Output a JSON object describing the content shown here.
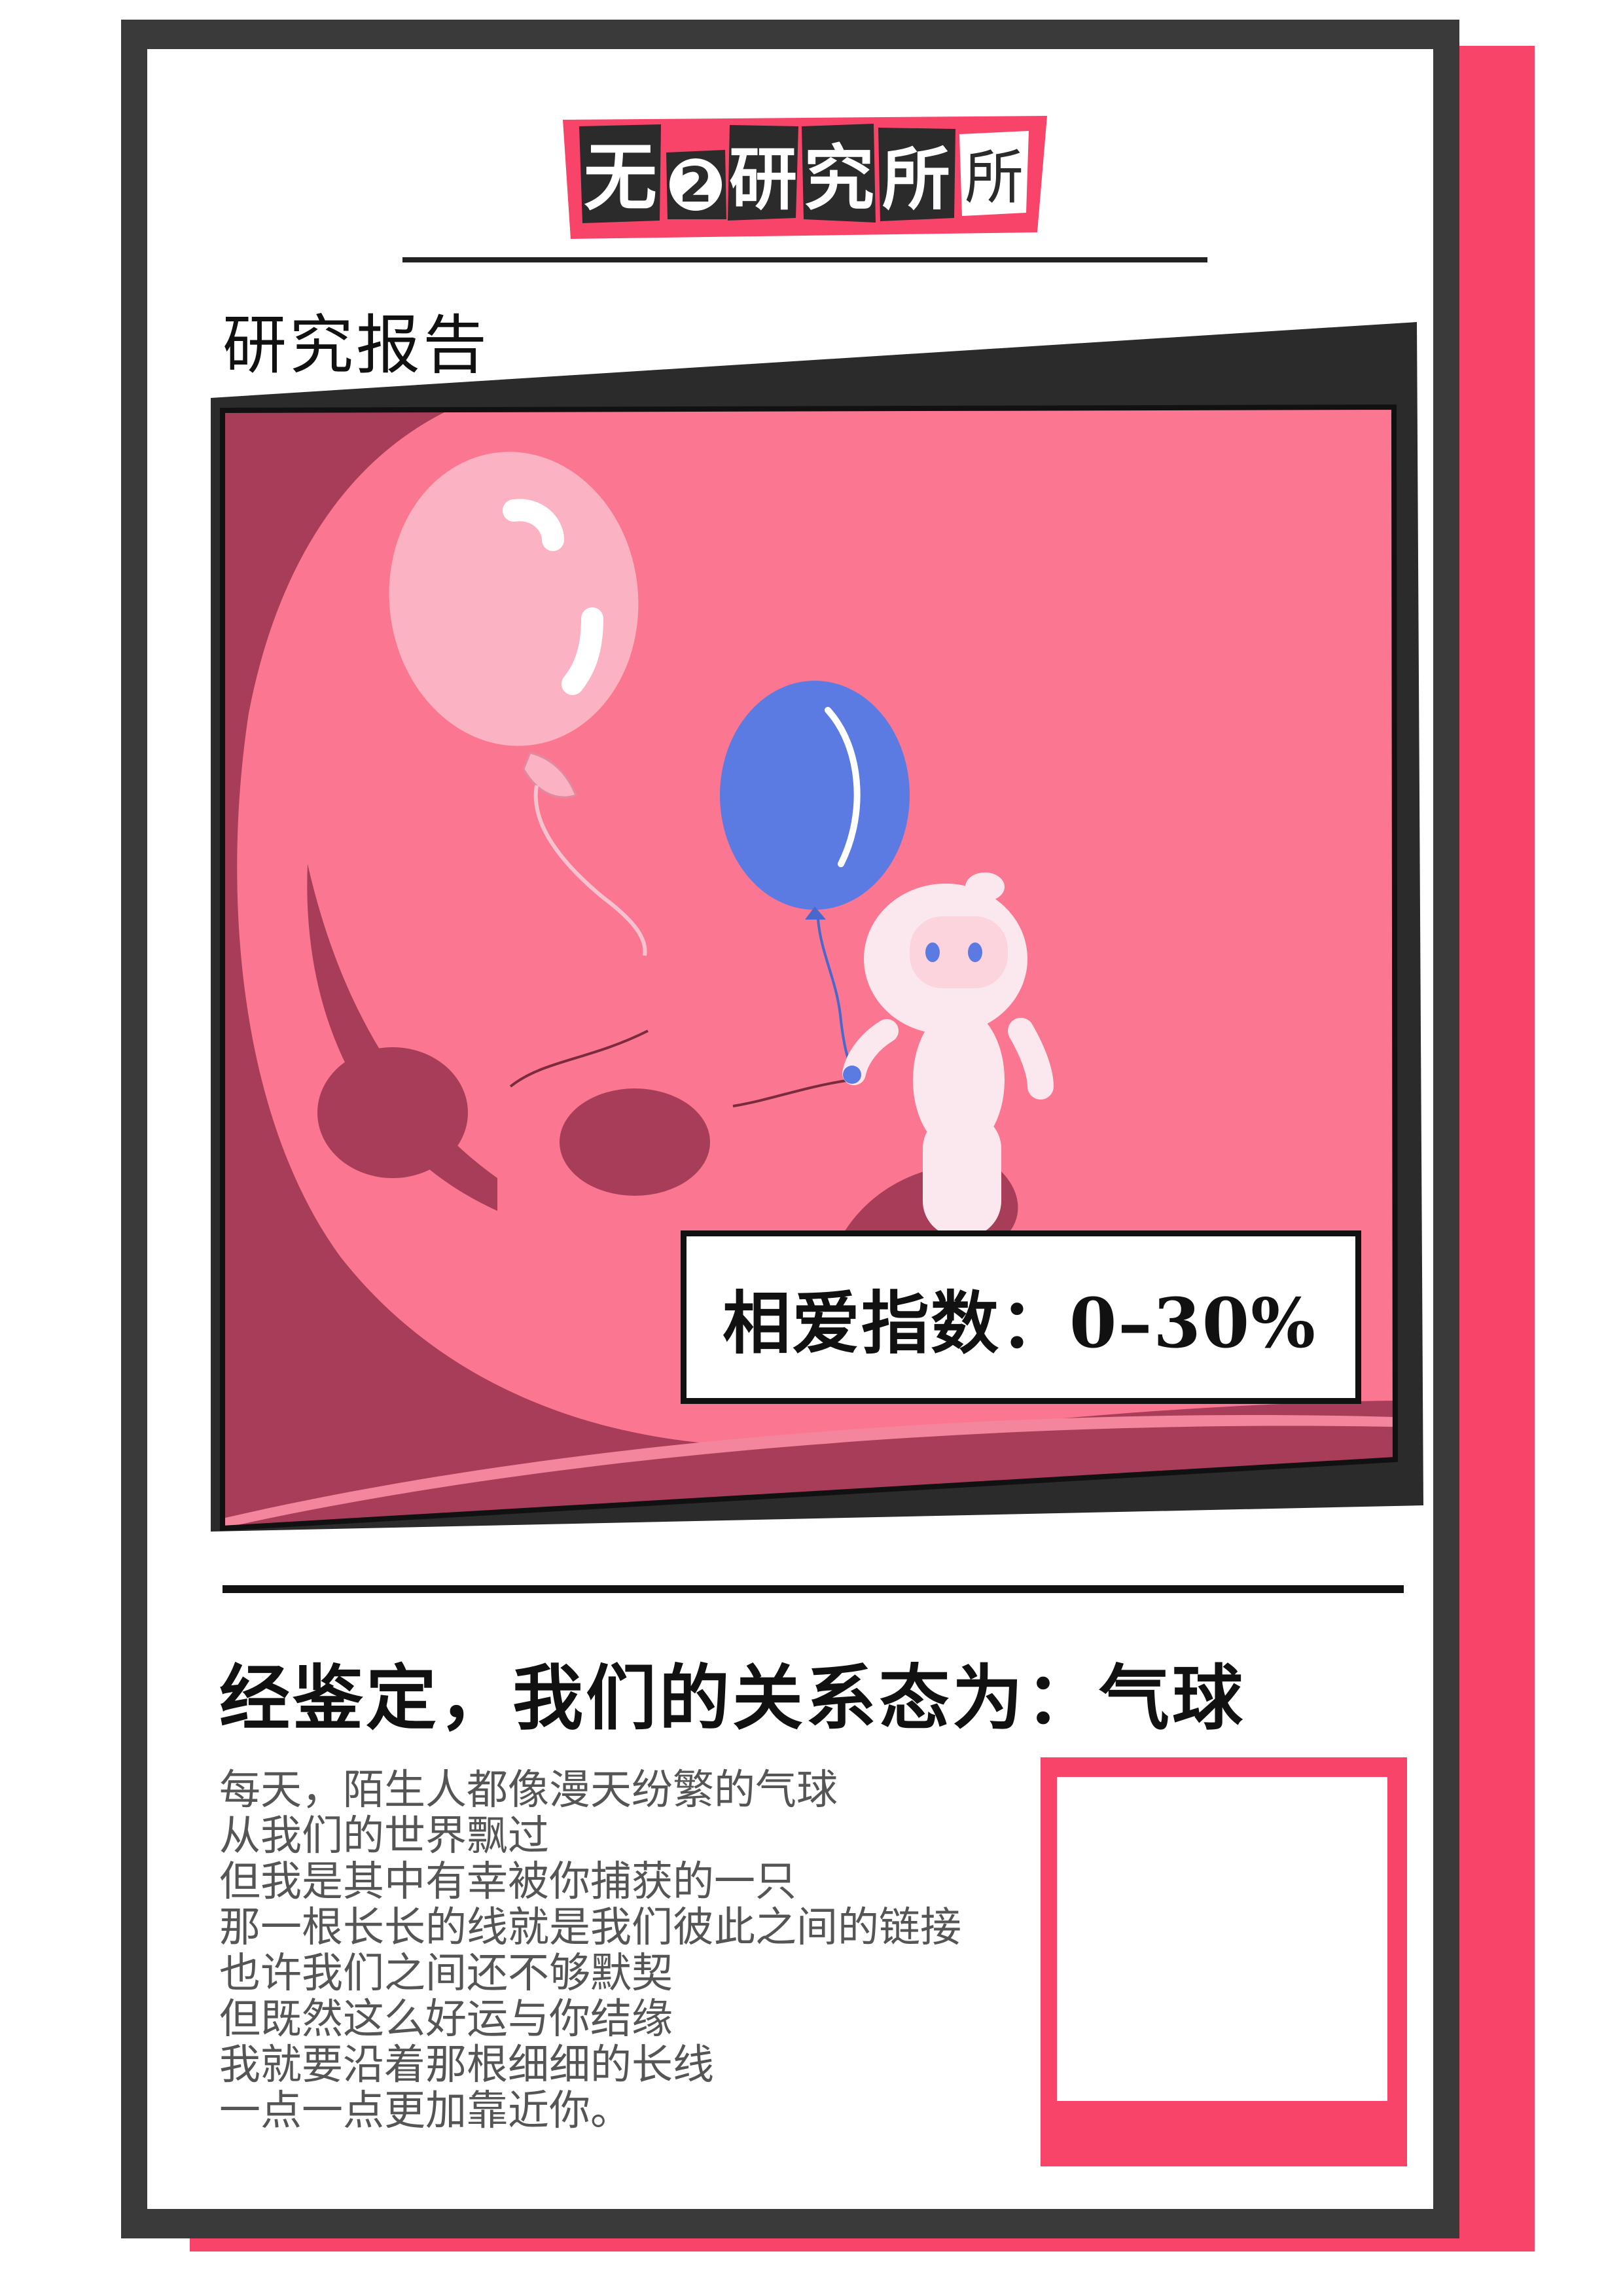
{
  "logo": {
    "chars": [
      "无",
      "2",
      "研",
      "究",
      "所"
    ]
  },
  "header": {
    "title": "研究报告"
  },
  "panel": {
    "score_label": "相爱指数：0–30%"
  },
  "verdict": "经鉴定，我们的关系态为：气球",
  "poem": {
    "lines": [
      "每天，陌生人都像漫天纷繁的气球",
      "从我们的世界飘过",
      "但我是其中有幸被你捕获的一只",
      "那一根长长的线就是我们彼此之间的链接",
      "也许我们之间还不够默契",
      "但既然这么好运与你结缘",
      "我就要沿着那根细细的长线",
      "一点一点更加靠近你。"
    ]
  },
  "colors": {
    "accent": "#f9446a",
    "frame": "#3a3a3a",
    "panel_bg": "#fb7791",
    "panel_dark": "#a83d59",
    "balloon_blue": "#5b7be3",
    "balloon_pink": "#fbb2c2"
  },
  "icons": [
    "pink-balloon-icon",
    "blue-balloon-icon",
    "astronaut-icon"
  ]
}
